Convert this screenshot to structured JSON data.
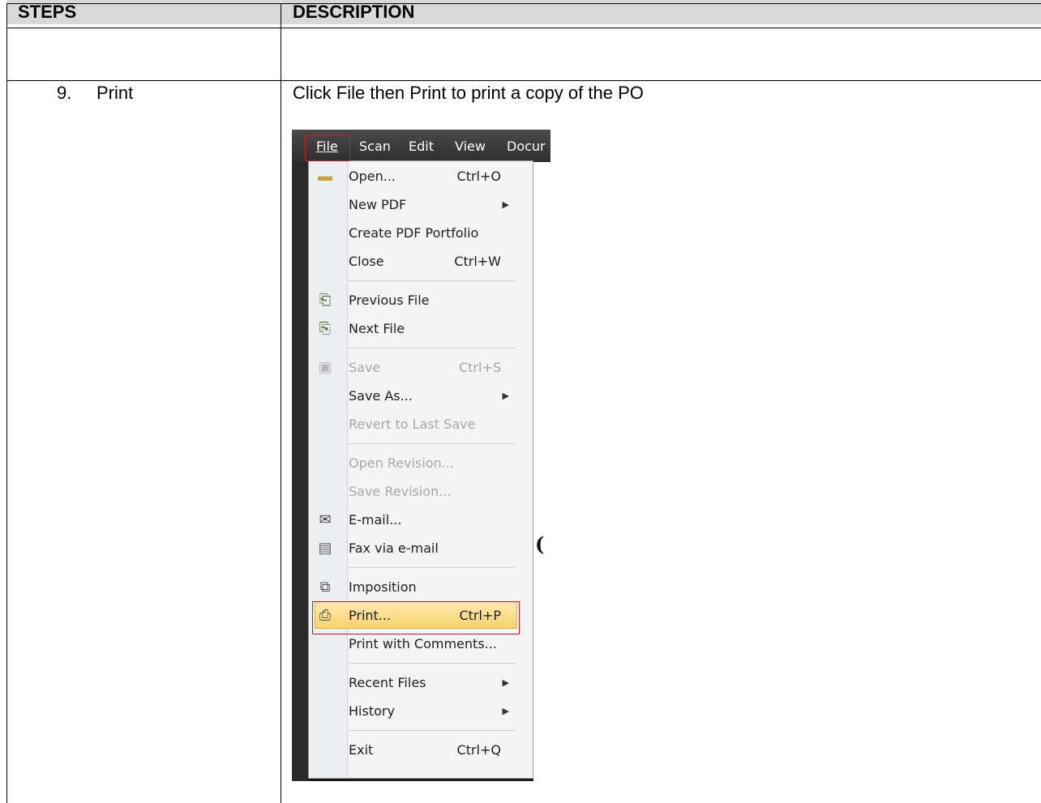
{
  "table": {
    "headers": {
      "steps": "STEPS",
      "description": "DESCRIPTION"
    },
    "row": {
      "step_number": "9.",
      "step_label": "Print",
      "description": "Click File then Print to print a copy of the PO"
    }
  },
  "screenshot": {
    "menubar": [
      "File",
      "Scan",
      "Edit",
      "View",
      "Docur"
    ],
    "file_menu": {
      "open": {
        "label": "Open...",
        "shortcut": "Ctrl+O"
      },
      "new_pdf": {
        "label": "New PDF"
      },
      "create_portfolio": {
        "label": "Create PDF Portfolio"
      },
      "close": {
        "label": "Close",
        "shortcut": "Ctrl+W"
      },
      "previous_file": {
        "label": "Previous File"
      },
      "next_file": {
        "label": "Next File"
      },
      "save": {
        "label": "Save",
        "shortcut": "Ctrl+S"
      },
      "save_as": {
        "label": "Save As..."
      },
      "revert": {
        "label": "Revert to Last Save"
      },
      "open_revision": {
        "label": "Open Revision..."
      },
      "save_revision": {
        "label": "Save Revision..."
      },
      "email": {
        "label": "E-mail..."
      },
      "fax": {
        "label": "Fax via e-mail"
      },
      "imposition": {
        "label": "Imposition"
      },
      "print": {
        "label": "Print...",
        "shortcut": "Ctrl+P"
      },
      "print_comments": {
        "label": "Print with Comments..."
      },
      "recent_files": {
        "label": "Recent Files"
      },
      "history": {
        "label": "History"
      },
      "exit": {
        "label": "Exit",
        "shortcut": "Ctrl+Q"
      }
    }
  }
}
